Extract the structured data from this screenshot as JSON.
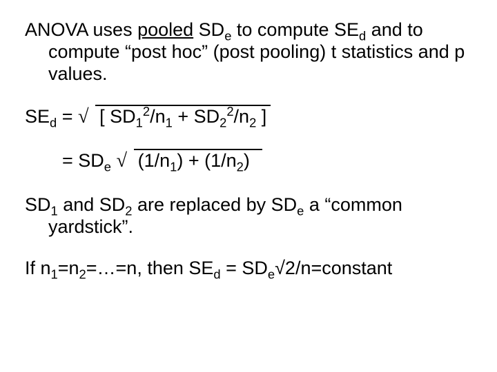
{
  "para1_l1a": "ANOVA uses ",
  "para1_l1b": "pooled",
  "para1_l1c": " SD",
  "para1_l1d": "e",
  "para1_l1e": " to compute SE",
  "para1_l1f": "d",
  "para1_l2": "and to compute “post hoc” (post pooling) t statistics and p values.",
  "eq1_lhs_a": "SE",
  "eq1_lhs_b": "d",
  "eq1_lhs_c": " = ",
  "sqrt": "√",
  "eq1_rhs_a": "[ SD",
  "eq1_rhs_b": "1",
  "eq1_rhs_c": "2",
  "eq1_rhs_d": "/n",
  "eq1_rhs_e": "1",
  "eq1_rhs_f": "  + SD",
  "eq1_rhs_g": "2",
  "eq1_rhs_h": "2",
  "eq1_rhs_i": "/n",
  "eq1_rhs_j": "2",
  "eq1_rhs_k": " ]",
  "eq2_lhs": "=   SD",
  "eq2_lhs_b": "e",
  "eq2_lhs_c": " ",
  "eq2_rhs_a": "(1/n",
  "eq2_rhs_b": "1",
  "eq2_rhs_c": ")  + (1/n",
  "eq2_rhs_d": "2",
  "eq2_rhs_e": ")",
  "para3_a": " SD",
  "para3_b": "1",
  "para3_c": " and SD",
  "para3_d": "2",
  "para3_e": " are replaced by SD",
  "para3_f": "e",
  "para3_g": " a “common yardstick”.",
  "para4_a": "If n",
  "para4_b": "1",
  "para4_c": "=n",
  "para4_d": "2",
  "para4_e": "=…=n, then SE",
  "para4_f": "d",
  "para4_g": " = SD",
  "para4_h": "e",
  "para4_i": "√2/n=constant"
}
